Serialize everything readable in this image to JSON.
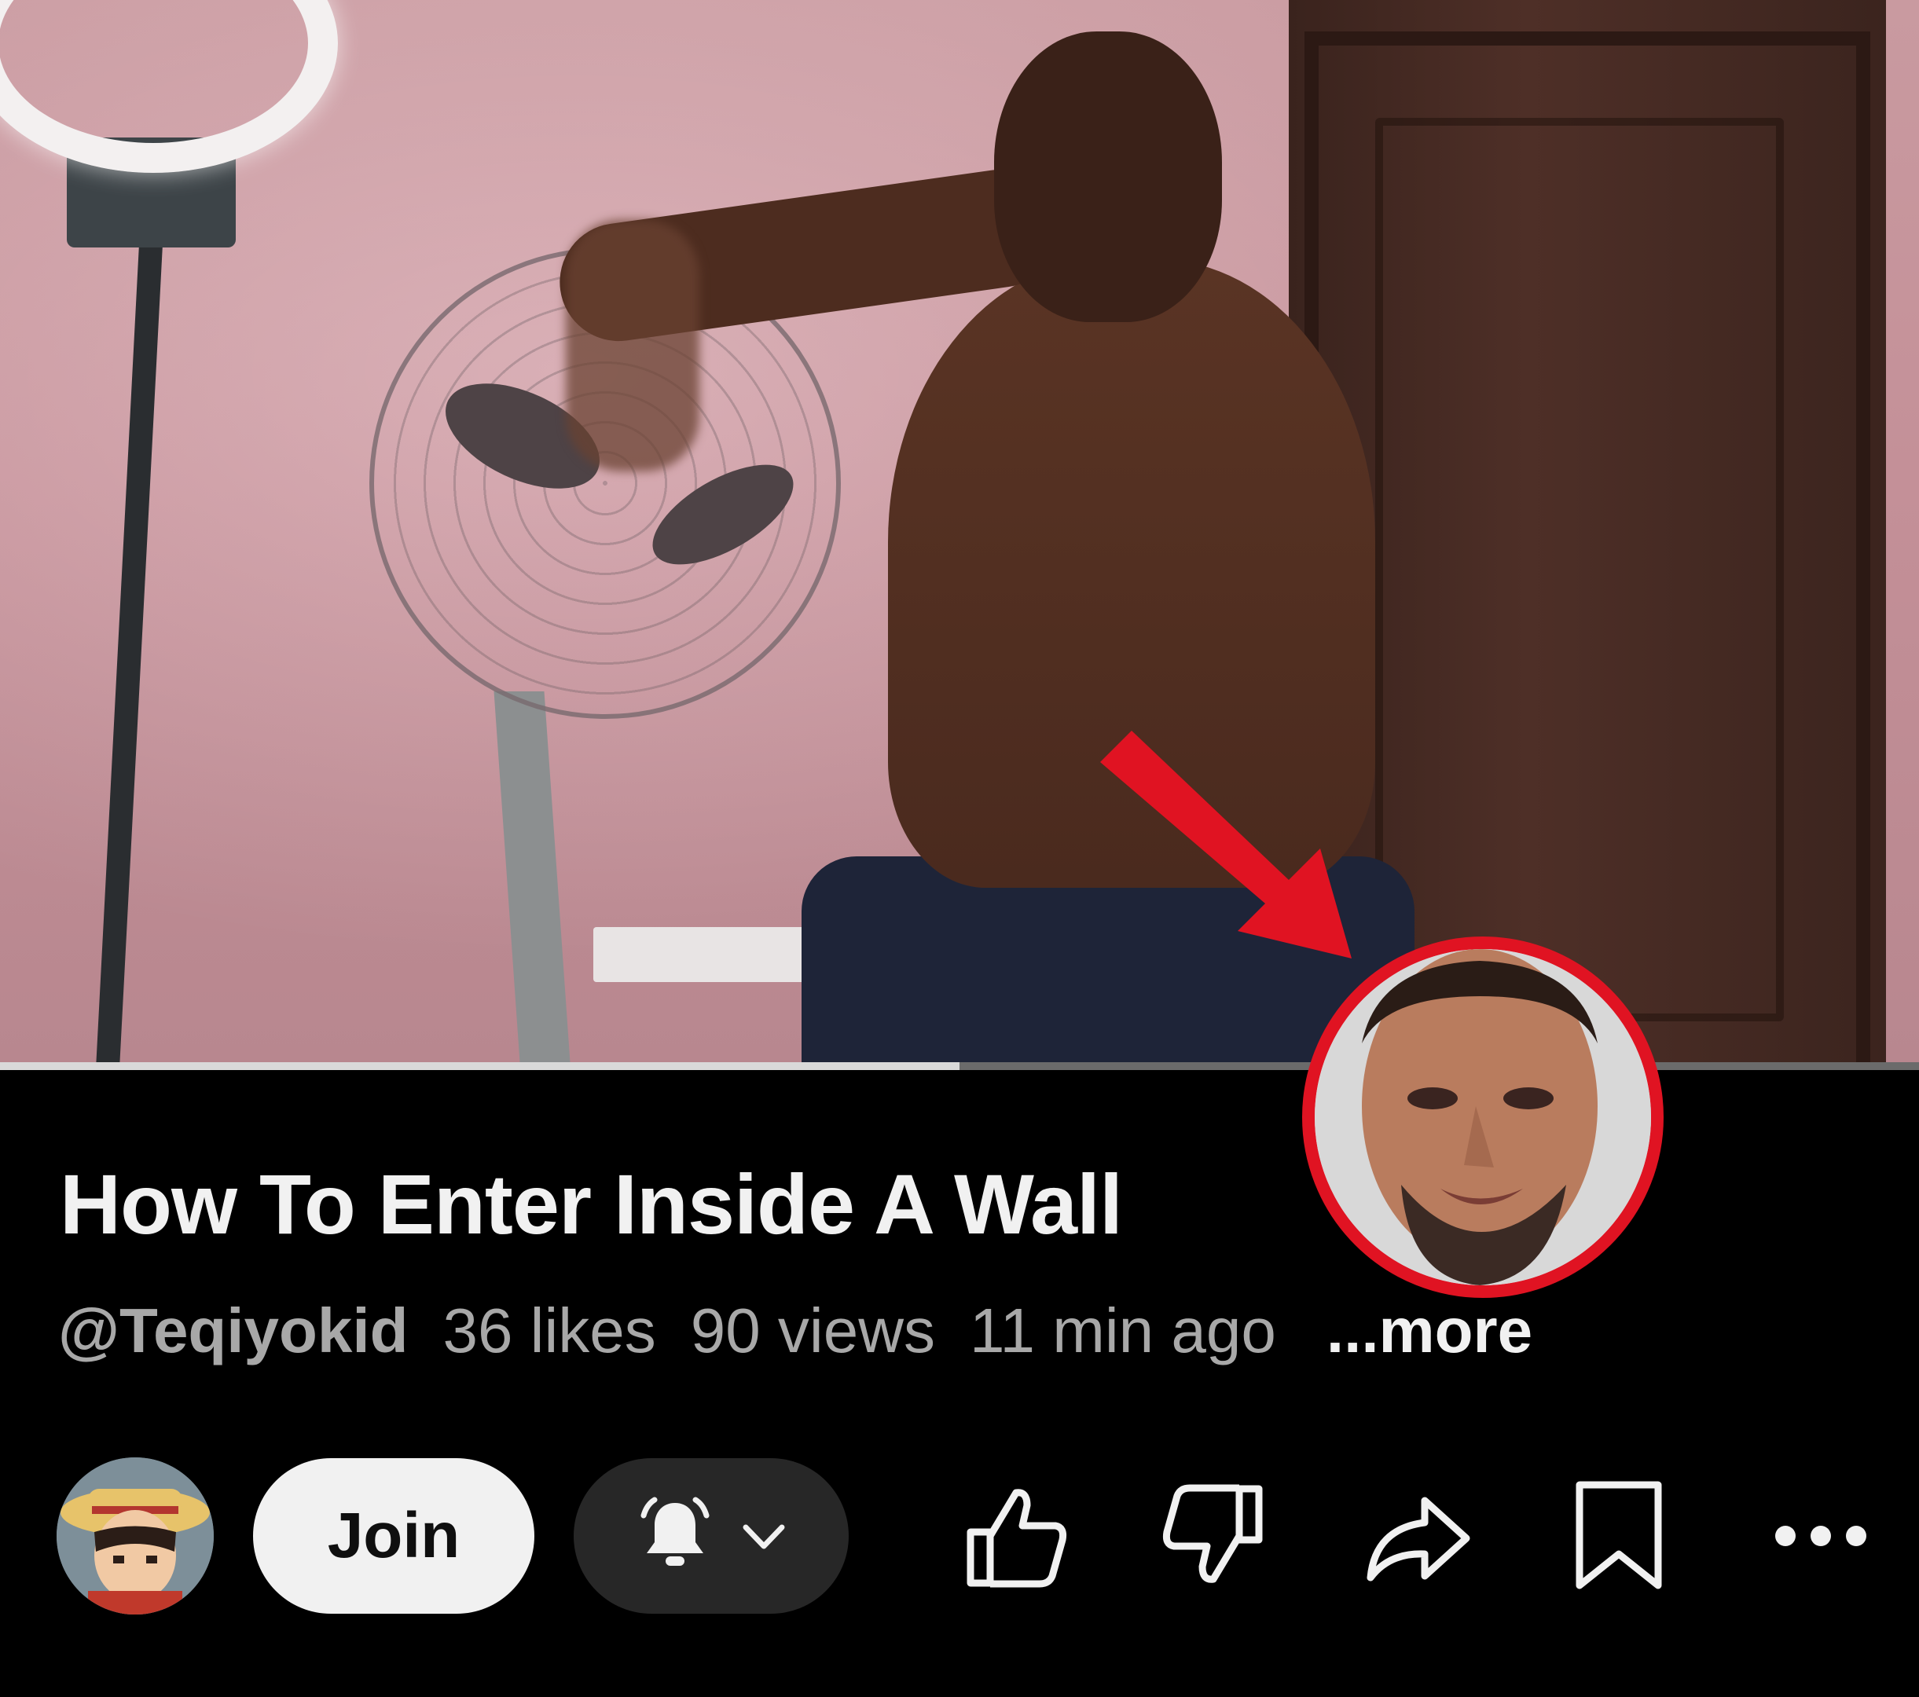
{
  "video": {
    "progress_fraction": 0.5
  },
  "title": "How To Enter Inside A Wall",
  "meta": {
    "channel": "@Teqiyokid",
    "likes": "36 likes",
    "views": "90 views",
    "time": "11 min ago",
    "more": "...more"
  },
  "actions": {
    "join_label": "Join",
    "icons": [
      "bell-icon",
      "chevron-down-icon",
      "thumbs-up-icon",
      "thumbs-down-icon",
      "share-icon",
      "save-icon",
      "more-icon"
    ]
  },
  "colors": {
    "background": "#000000",
    "title": "#f1f1f1",
    "meta": "#a8a8a8",
    "join_bg": "#f1f1f1",
    "bell_bg": "#272727",
    "annotation_red": "#e01322"
  }
}
